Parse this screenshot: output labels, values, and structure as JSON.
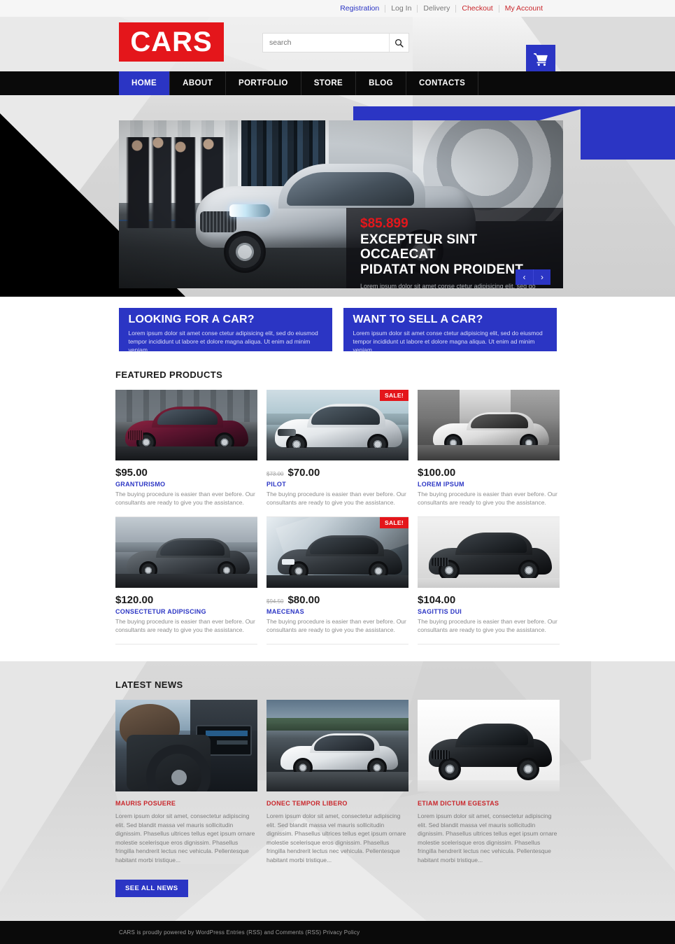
{
  "utilbar": {
    "links": [
      {
        "label": "Registration",
        "style": "reg"
      },
      {
        "label": "Log In",
        "style": "gray"
      },
      {
        "label": "Delivery",
        "style": "gray"
      },
      {
        "label": "Checkout",
        "style": "red"
      },
      {
        "label": "My Account",
        "style": "red"
      }
    ]
  },
  "header": {
    "logo": "CARS",
    "search_placeholder": "search",
    "search_value": "",
    "search_icon": "search-icon",
    "cart_icon": "shopping-cart-icon"
  },
  "nav": {
    "items": [
      {
        "label": "HOME",
        "active": true
      },
      {
        "label": "ABOUT",
        "active": false
      },
      {
        "label": "PORTFOLIO",
        "active": false
      },
      {
        "label": "STORE",
        "active": false
      },
      {
        "label": "BLOG",
        "active": false
      },
      {
        "label": "CONTACTS",
        "active": false
      }
    ]
  },
  "hero": {
    "price": "$85.899",
    "title_line1": "EXCEPTEUR SINT OCCAECAT",
    "title_line2": "PIDATAT NON PROIDENT",
    "description": "Lorem ipsum dolor sit amet conse ctetur adipisicing elit, sed do eiusmod tempor incididunt ut labore et dolore magna aliqua. Ut enim ad minim veniam",
    "prev_label": "‹",
    "next_label": "›"
  },
  "callouts": [
    {
      "title": "LOOKING FOR A CAR?",
      "text": "Lorem ipsum dolor sit amet conse ctetur adipisicing elit, sed do eiusmod tempor incididunt ut labore et dolore magna aliqua. Ut enim ad minim veniam"
    },
    {
      "title": "WANT TO SELL A CAR?",
      "text": "Lorem ipsum dolor sit amet conse ctetur adipisicing elit, sed do eiusmod tempor incididunt ut labore et dolore magna aliqua. Ut enim ad minim veniam"
    }
  ],
  "featured": {
    "title": "FEATURED PRODUCTS",
    "description_default": "The buying procedure is easier than ever before. Our consultants are ready to give you the assistance.",
    "items": [
      {
        "price": "$95.00",
        "old_price": "",
        "name": "GRANTURISMO",
        "sale": false,
        "desc": "The buying procedure is easier than ever before. Our consultants are ready to give you the assistance."
      },
      {
        "price": "$70.00",
        "old_price": "$73.00",
        "name": "PILOT",
        "sale": true,
        "desc": "The buying procedure is easier than ever before. Our consultants are ready to give you the assistance."
      },
      {
        "price": "$100.00",
        "old_price": "",
        "name": "LOREM IPSUM",
        "sale": false,
        "desc": "The buying procedure is easier than ever before. Our consultants are ready to give you the assistance."
      },
      {
        "price": "$120.00",
        "old_price": "",
        "name": "CONSECTETUR ADIPISCING",
        "sale": false,
        "desc": "The buying procedure is easier than ever before. Our consultants are ready to give you the assistance."
      },
      {
        "price": "$80.00",
        "old_price": "$94.50",
        "name": "MAECENAS",
        "sale": true,
        "desc": "The buying procedure is easier than ever before. Our consultants are ready to give you the assistance."
      },
      {
        "price": "$104.00",
        "old_price": "",
        "name": "SAGITTIS DUI",
        "sale": false,
        "desc": "The buying procedure is easier than ever before. Our consultants are ready to give you the assistance."
      }
    ],
    "sale_badge": "SALE!"
  },
  "news": {
    "title": "LATEST NEWS",
    "button": "SEE ALL NEWS",
    "items": [
      {
        "title": "MAURIS POSUERE",
        "text": "Lorem ipsum dolor sit amet, consectetur adipiscing elit. Sed blandit massa vel mauris sollicitudin dignissim. Phasellus ultrices tellus eget ipsum ornare molestie scelerisque eros dignissim. Phasellus fringilla hendrerit lectus nec vehicula. Pellentesque habitant morbi tristique..."
      },
      {
        "title": "DONEC TEMPOR LIBERO",
        "text": "Lorem ipsum dolor sit amet, consectetur adipiscing elit. Sed blandit massa vel mauris sollicitudin dignissim. Phasellus ultrices tellus eget ipsum ornare molestie scelerisque eros dignissim. Phasellus fringilla hendrerit lectus nec vehicula. Pellentesque habitant morbi tristique..."
      },
      {
        "title": "ETIAM DICTUM EGESTAS",
        "text": "Lorem ipsum dolor sit amet, consectetur adipiscing elit. Sed blandit massa vel mauris sollicitudin dignissim. Phasellus ultrices tellus eget ipsum ornare molestie scelerisque eros dignissim. Phasellus fringilla hendrerit lectus nec vehicula. Pellentesque habitant morbi tristique..."
      }
    ]
  },
  "footer": {
    "text": "CARS is proudly powered by WordPress Entries (RSS) and Comments (RSS) Privacy Policy"
  },
  "colors": {
    "brand_red": "#e4161b",
    "brand_blue": "#2b35c4",
    "link_red": "#c9262b",
    "nav_black": "#0a0a0a"
  }
}
